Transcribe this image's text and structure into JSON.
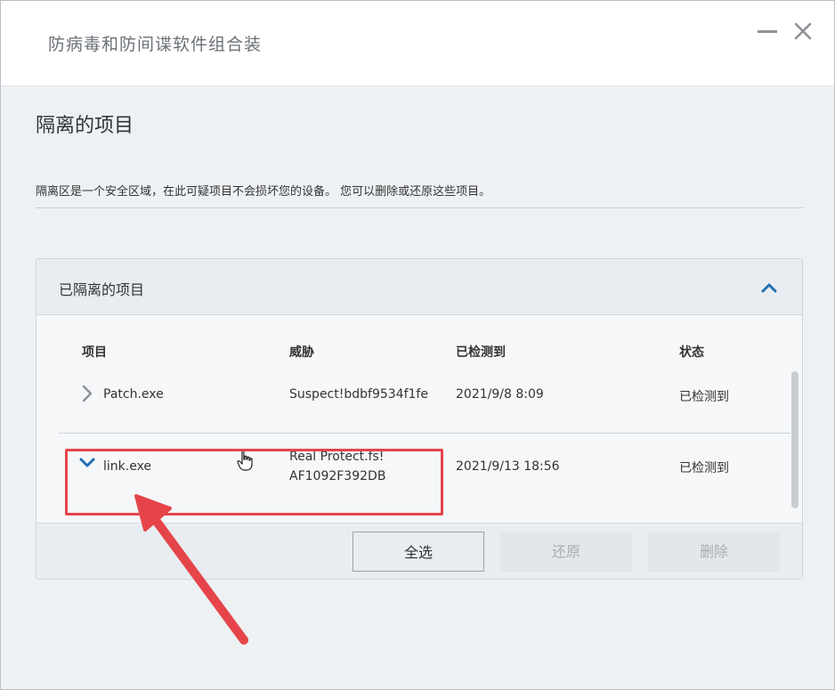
{
  "window": {
    "title": "防病毒和防间谍软件组合装"
  },
  "page": {
    "title": "隔离的项目",
    "description": "隔离区是一个安全区域，在此可疑项目不会损坏您的设备。 您可以删除或还原这些项目。"
  },
  "panel": {
    "title": "已隔离的项目",
    "columns": [
      "项目",
      "威胁",
      "已检测到",
      "状态"
    ],
    "rows": [
      {
        "item": "Patch.exe",
        "threat_line1": "Suspect!bdbf9534f1fe",
        "threat_line2": "",
        "detected": "2021/9/8 8:09",
        "status": "已检测到",
        "expanded": false
      },
      {
        "item": "link.exe",
        "threat_line1": "Real Protect.fs!",
        "threat_line2": "AF1092F392DB",
        "detected": "2021/9/13 18:56",
        "status": "已检测到",
        "expanded": true
      }
    ]
  },
  "buttons": {
    "select_all": "全选",
    "restore": "还原",
    "delete": "删除"
  },
  "colors": {
    "accent": "#1f6fb2",
    "annotation": "#e5454a"
  },
  "icons": {
    "minimize": "minimize-icon",
    "close": "close-icon",
    "collapse": "chevron-up-icon",
    "row_collapsed": "chevron-right-icon",
    "row_expanded": "chevron-down-icon",
    "cursor": "hand-cursor-icon"
  }
}
